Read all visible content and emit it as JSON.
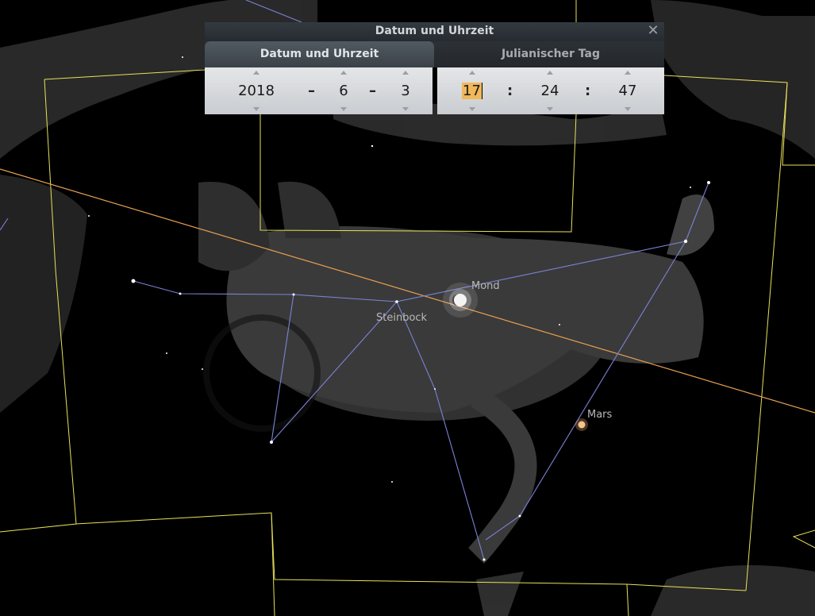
{
  "dialog": {
    "title": "Datum und Uhrzeit",
    "tab_datetime": "Datum und Uhrzeit",
    "tab_julian": "Julianischer Tag",
    "close_glyph": "✕",
    "date": {
      "year": "2018",
      "month": "6",
      "day": "3",
      "sep1": "–",
      "sep2": "–"
    },
    "time": {
      "hour": "17",
      "minute": "24",
      "second": "47",
      "sep1": ":",
      "sep2": ":"
    }
  },
  "sky": {
    "labels": {
      "moon": "Mond",
      "mars": "Mars",
      "constellation": "Steinbock"
    }
  },
  "colors": {
    "boundary": "#e8e05a",
    "ecliptic": "#e8a050",
    "constellation_lines": "#7c82d6",
    "dialog_highlight": "#f0b85a"
  }
}
